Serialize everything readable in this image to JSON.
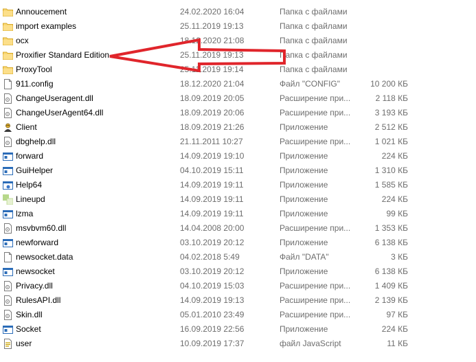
{
  "files": [
    {
      "name": "Annoucement",
      "date": "24.02.2020 16:04",
      "type": "Папка с файлами",
      "size": "",
      "icon": "folder-icon"
    },
    {
      "name": "import examples",
      "date": "25.11.2019 19:13",
      "type": "Папка с файлами",
      "size": "",
      "icon": "folder-icon"
    },
    {
      "name": "ocx",
      "date": "18.12.2020 21:08",
      "type": "Папка с файлами",
      "size": "",
      "icon": "folder-icon"
    },
    {
      "name": "Proxifier Standard Edition",
      "date": "25.11.2019 19:13",
      "type": "Папка с файлами",
      "size": "",
      "icon": "folder-icon"
    },
    {
      "name": "ProxyTool",
      "date": "25.11.2019 19:14",
      "type": "Папка с файлами",
      "size": "",
      "icon": "folder-icon"
    },
    {
      "name": "911.config",
      "date": "18.12.2020 21:04",
      "type": "Файл \"CONFIG\"",
      "size": "10 200 КБ",
      "icon": "file-icon"
    },
    {
      "name": "ChangeUseragent.dll",
      "date": "18.09.2019 20:05",
      "type": "Расширение при...",
      "size": "2 118 КБ",
      "icon": "dll-file-icon"
    },
    {
      "name": "ChangeUserAgent64.dll",
      "date": "18.09.2019 20:06",
      "type": "Расширение при...",
      "size": "3 193 КБ",
      "icon": "dll-file-icon"
    },
    {
      "name": "Client",
      "date": "18.09.2019 21:26",
      "type": "Приложение",
      "size": "2 512 КБ",
      "icon": "client-app-icon"
    },
    {
      "name": "dbghelp.dll",
      "date": "21.11.2011 10:27",
      "type": "Расширение при...",
      "size": "1 021 КБ",
      "icon": "dll-file-icon"
    },
    {
      "name": "forward",
      "date": "14.09.2019 19:10",
      "type": "Приложение",
      "size": "224 КБ",
      "icon": "app-window-icon"
    },
    {
      "name": "GuiHelper",
      "date": "04.10.2019 15:11",
      "type": "Приложение",
      "size": "1 310 КБ",
      "icon": "app-window-icon"
    },
    {
      "name": "Help64",
      "date": "14.09.2019 19:11",
      "type": "Приложение",
      "size": "1 585 КБ",
      "icon": "help-app-icon"
    },
    {
      "name": "Lineupd",
      "date": "14.09.2019 19:11",
      "type": "Приложение",
      "size": "224 КБ",
      "icon": "lineupd-app-icon"
    },
    {
      "name": "lzma",
      "date": "14.09.2019 19:11",
      "type": "Приложение",
      "size": "99 КБ",
      "icon": "app-window-icon"
    },
    {
      "name": "msvbvm60.dll",
      "date": "14.04.2008 20:00",
      "type": "Расширение при...",
      "size": "1 353 КБ",
      "icon": "dll-file-icon"
    },
    {
      "name": "newforward",
      "date": "03.10.2019 20:12",
      "type": "Приложение",
      "size": "6 138 КБ",
      "icon": "app-window-icon"
    },
    {
      "name": "newsocket.data",
      "date": "04.02.2018 5:49",
      "type": "Файл \"DATA\"",
      "size": "3 КБ",
      "icon": "file-icon"
    },
    {
      "name": "newsocket",
      "date": "03.10.2019 20:12",
      "type": "Приложение",
      "size": "6 138 КБ",
      "icon": "app-window-icon"
    },
    {
      "name": "Privacy.dll",
      "date": "04.10.2019 15:03",
      "type": "Расширение при...",
      "size": "1 409 КБ",
      "icon": "dll-file-icon"
    },
    {
      "name": "RulesAPI.dll",
      "date": "14.09.2019 19:13",
      "type": "Расширение при...",
      "size": "2 139 КБ",
      "icon": "dll-file-icon"
    },
    {
      "name": "Skin.dll",
      "date": "05.01.2010 23:49",
      "type": "Расширение при...",
      "size": "97 КБ",
      "icon": "dll-file-icon"
    },
    {
      "name": "Socket",
      "date": "16.09.2019 22:56",
      "type": "Приложение",
      "size": "224 КБ",
      "icon": "app-window-icon"
    },
    {
      "name": "user",
      "date": "10.09.2019 17:37",
      "type": "файл JavaScript",
      "size": "11 КБ",
      "icon": "javascript-file-icon"
    }
  ],
  "annotation": {
    "color": "#e0252b",
    "points_to": "Proxifier Standard Edition"
  }
}
